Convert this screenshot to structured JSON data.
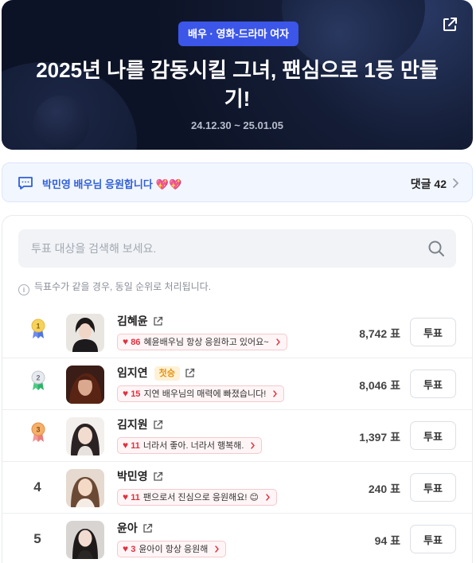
{
  "hero": {
    "category_badge": "배우 · 영화-드라마 여자",
    "title": "2025년 나를 감동시킬 그녀, 팬심으로 1등 만들기!",
    "period": "24.12.30 ~ 25.01.05",
    "share_icon": "external-link-icon"
  },
  "cheer": {
    "message": "박민영 배우님 응원합니다",
    "emoji": "💖💖",
    "comments_label": "댓글 42"
  },
  "search": {
    "placeholder": "투표 대상을 검색해 보세요."
  },
  "notice": "득표수가 같을 경우, 동일 순위로 처리됩니다.",
  "colors": {
    "accent": "#3b56e8",
    "heart": "#e0303f",
    "gold": "#f2c94c",
    "silver": "#c9ced6",
    "bronze": "#f2a25c"
  },
  "rankings": [
    {
      "rank": "1",
      "medal": "gold",
      "name": "김혜윤",
      "badge": "",
      "cheer_count": "86",
      "cheer_text": "혜윤배우님 항상 응원하고 있어요~",
      "votes": "8,742 표",
      "vote_label": "투표"
    },
    {
      "rank": "2",
      "medal": "silver",
      "name": "임지연",
      "badge": "첫승",
      "cheer_count": "15",
      "cheer_text": "지연 배우님의 매력에 빠졌습니다!",
      "votes": "8,046 표",
      "vote_label": "투표"
    },
    {
      "rank": "3",
      "medal": "bronze",
      "name": "김지원",
      "badge": "",
      "cheer_count": "11",
      "cheer_text": "너라서 좋아. 너라서 행복해.",
      "votes": "1,397 표",
      "vote_label": "투표"
    },
    {
      "rank": "4",
      "medal": "",
      "name": "박민영",
      "badge": "",
      "cheer_count": "11",
      "cheer_text": "팬으로서 진심으로 응원해요! 😊",
      "votes": "240 표",
      "vote_label": "투표"
    },
    {
      "rank": "5",
      "medal": "",
      "name": "윤아",
      "badge": "",
      "cheer_count": "3",
      "cheer_text": "윤아이 항상 응원해",
      "votes": "94 표",
      "vote_label": "투표"
    }
  ]
}
